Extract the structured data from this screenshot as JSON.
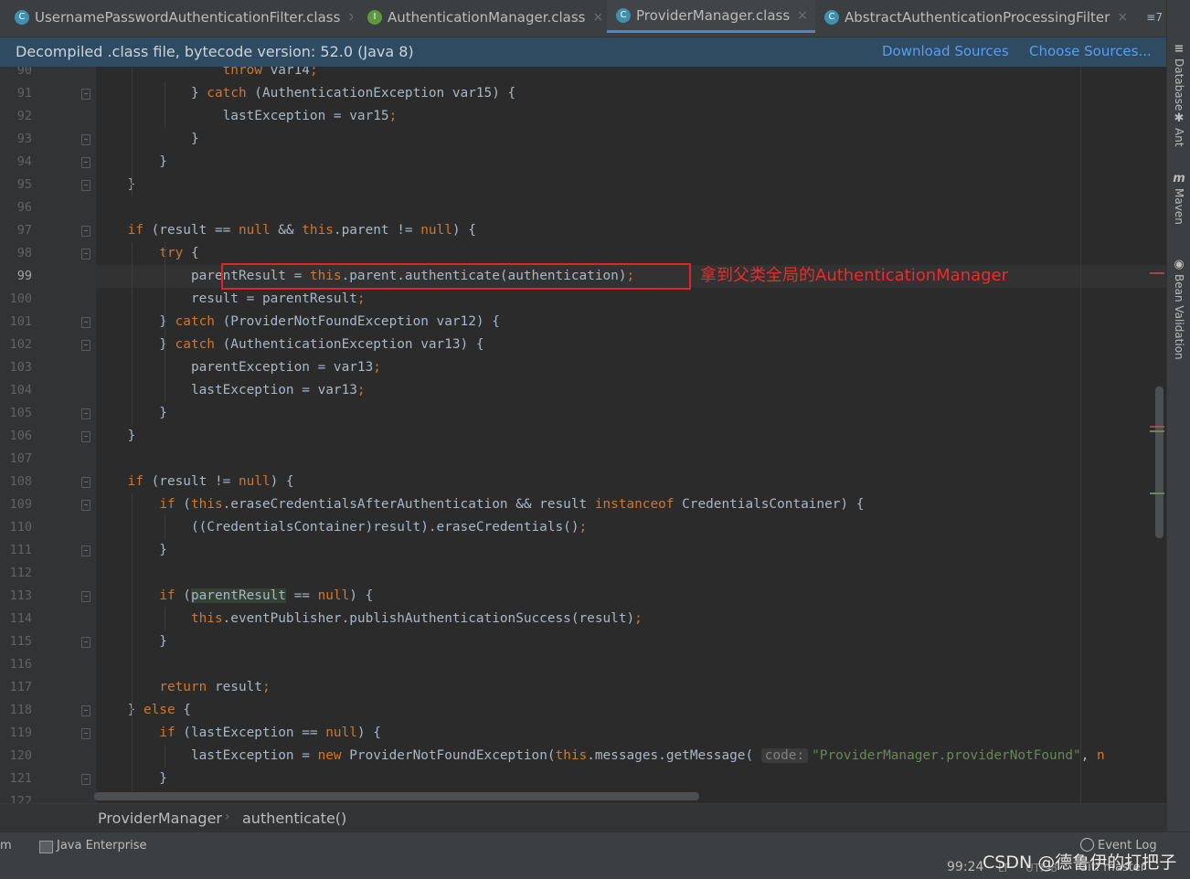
{
  "tabs": [
    {
      "label": "UsernamePasswordAuthenticationFilter.class",
      "kind": "class",
      "active": false
    },
    {
      "label": "AuthenticationManager.class",
      "kind": "interface",
      "active": false
    },
    {
      "label": "ProviderManager.class",
      "kind": "class",
      "active": true
    },
    {
      "label": "AbstractAuthenticationProcessingFilter",
      "kind": "class",
      "active": false
    }
  ],
  "tab_overflow": "≡7",
  "banner": {
    "text": "Decompiled .class file, bytecode version: 52.0 (Java 8)",
    "download_sources": "Download Sources",
    "choose_sources": "Choose Sources..."
  },
  "editor": {
    "current_line": 99,
    "lines": [
      {
        "num": "90",
        "text": "                throw var14;"
      },
      {
        "num": "91",
        "text": "            } catch (AuthenticationException var15) {"
      },
      {
        "num": "92",
        "text": "                lastException = var15;"
      },
      {
        "num": "93",
        "text": "            }"
      },
      {
        "num": "94",
        "text": "        }"
      },
      {
        "num": "95",
        "text": "    }"
      },
      {
        "num": "96",
        "text": ""
      },
      {
        "num": "97",
        "text": "    if (result == null && this.parent != null) {"
      },
      {
        "num": "98",
        "text": "        try {"
      },
      {
        "num": "99",
        "text": "            parentResult = this.parent.authenticate(authentication);"
      },
      {
        "num": "100",
        "text": "            result = parentResult;"
      },
      {
        "num": "101",
        "text": "        } catch (ProviderNotFoundException var12) {"
      },
      {
        "num": "102",
        "text": "        } catch (AuthenticationException var13) {"
      },
      {
        "num": "103",
        "text": "            parentException = var13;"
      },
      {
        "num": "104",
        "text": "            lastException = var13;"
      },
      {
        "num": "105",
        "text": "        }"
      },
      {
        "num": "106",
        "text": "    }"
      },
      {
        "num": "107",
        "text": ""
      },
      {
        "num": "108",
        "text": "    if (result != null) {"
      },
      {
        "num": "109",
        "text": "        if (this.eraseCredentialsAfterAuthentication && result instanceof CredentialsContainer) {"
      },
      {
        "num": "110",
        "text": "            ((CredentialsContainer)result).eraseCredentials();"
      },
      {
        "num": "111",
        "text": "        }"
      },
      {
        "num": "112",
        "text": ""
      },
      {
        "num": "113",
        "text": "        if (parentResult == null) {"
      },
      {
        "num": "114",
        "text": "            this.eventPublisher.publishAuthenticationSuccess(result);"
      },
      {
        "num": "115",
        "text": "        }"
      },
      {
        "num": "116",
        "text": ""
      },
      {
        "num": "117",
        "text": "        return result;"
      },
      {
        "num": "118",
        "text": "    } else {"
      },
      {
        "num": "119",
        "text": "        if (lastException == null) {"
      },
      {
        "num": "120",
        "text": "            lastException = new ProviderNotFoundException(this.messages.getMessage( code: \"ProviderManager.providerNotFound\", n"
      },
      {
        "num": "121",
        "text": "        }"
      },
      {
        "num": "122",
        "text": ""
      }
    ],
    "param_hint": "code:"
  },
  "annotation": {
    "text": "拿到父类全局的AuthenticationManager",
    "color": "#e0242a"
  },
  "breadcrumb": {
    "class_name": "ProviderManager",
    "method": "authenticate()"
  },
  "right_tools": [
    {
      "label": "Database",
      "icon": "database-icon"
    },
    {
      "label": "Ant",
      "icon": "ant-icon"
    },
    {
      "label": "Maven",
      "icon": "maven-icon"
    },
    {
      "label": "Bean Validation",
      "icon": "bean-validation-icon"
    }
  ],
  "bottom_tools": {
    "left_cut": "m",
    "java_enterprise": "Java Enterprise",
    "event_log": "Event Log"
  },
  "status": {
    "position": "99:24",
    "line_sep": "LF",
    "encoding": "UTF-8",
    "git": "Git: master"
  },
  "watermark": "CSDN @德鲁伊的打把子",
  "colors": {
    "keyword": "#cc7832",
    "string": "#6a8759",
    "text": "#a9b7c6",
    "link": "#589df6",
    "annotation": "#e0242a"
  }
}
